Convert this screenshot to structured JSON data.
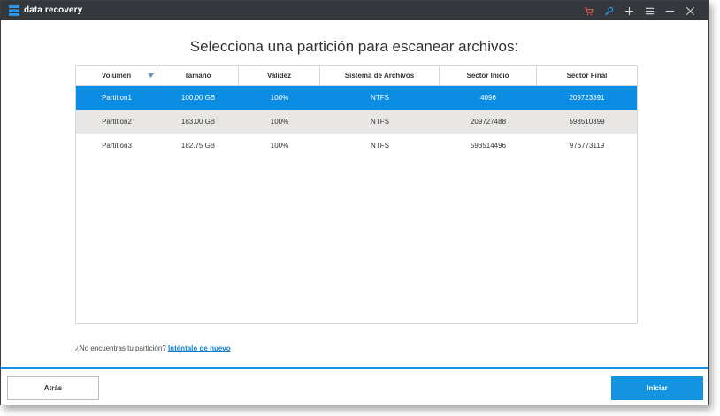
{
  "app": {
    "title": "data recovery",
    "colors": {
      "titlebar": "#34373c",
      "accent": "#1494e0",
      "selected_row": "#0b8de4",
      "cart_icon": "#e0584c",
      "key_icon": "#2f95e0"
    }
  },
  "titlebar": {
    "icons": [
      "cart-icon",
      "key-icon",
      "plus-icon",
      "menu-icon",
      "minimize-icon",
      "close-icon"
    ]
  },
  "main": {
    "heading": "Selecciona una partición para escanear archivos:"
  },
  "table": {
    "columns": [
      "Volumen",
      "Tamaño",
      "Validez",
      "Sistema de Archivos",
      "Sector Inicio",
      "Sector Final"
    ],
    "rows": [
      [
        "Partition1",
        "100.00 GB",
        "100%",
        "NTFS",
        "4096",
        "209723391"
      ],
      [
        "Partition2",
        "183.00 GB",
        "100%",
        "NTFS",
        "209727488",
        "593510399"
      ],
      [
        "Partition3",
        "182.75 GB",
        "100%",
        "NTFS",
        "593514496",
        "976773119"
      ]
    ],
    "selected_row": "Partition1"
  },
  "hint": {
    "text": "¿No encuentras tu partición? ",
    "link": "Inténtalo de nuevo"
  },
  "footer": {
    "back_label": "Atrás",
    "start_label": "Iniciar"
  }
}
